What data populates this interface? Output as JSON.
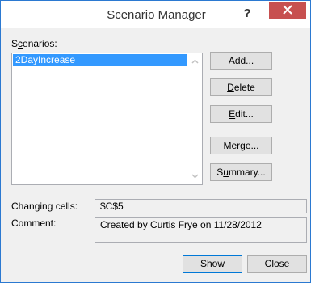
{
  "window": {
    "title": "Scenario Manager",
    "help_glyph": "?",
    "close_glyph": "×"
  },
  "scenarios": {
    "label_pre": "S",
    "label_u": "c",
    "label_post": "enarios:",
    "items": [
      "2DayIncrease"
    ],
    "selected_index": 0
  },
  "buttons": {
    "add": {
      "u": "A",
      "rest": "dd..."
    },
    "delete": {
      "u": "D",
      "rest": "elete"
    },
    "edit": {
      "u": "E",
      "rest": "dit..."
    },
    "merge": {
      "u": "M",
      "rest": "erge..."
    },
    "summary": {
      "pre": "S",
      "u": "u",
      "rest": "mmary..."
    }
  },
  "changing_cells": {
    "label": "Changing cells:",
    "value": "$C$5"
  },
  "comment": {
    "label": "Comment:",
    "value": "Created by Curtis Frye on 11/28/2012"
  },
  "footer": {
    "show": {
      "u": "S",
      "rest": "how"
    },
    "close": "Close"
  },
  "colors": {
    "selection": "#3399ff",
    "close_button": "#c75050",
    "border_accent": "#2b79d1"
  }
}
